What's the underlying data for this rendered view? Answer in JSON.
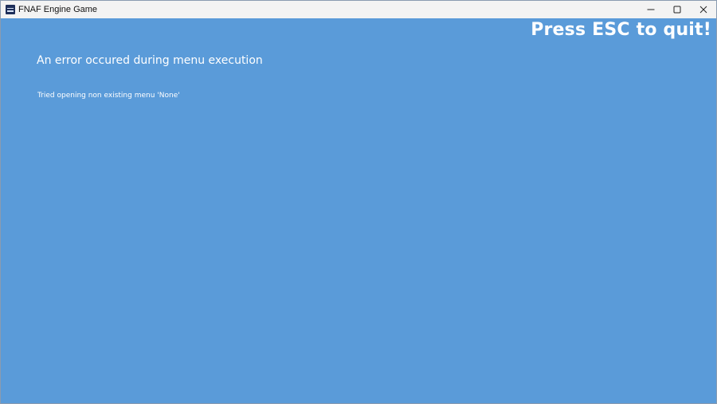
{
  "window": {
    "title": "FNAF Engine Game",
    "app_icon": "app-logo-icon",
    "controls": [
      "minimize-icon",
      "maximize-icon",
      "close-icon"
    ]
  },
  "content": {
    "background_color": "#5a9bd9",
    "esc_hint": "Press ESC to quit!",
    "error_title": "An error occured during menu execution",
    "error_detail": "Tried opening non existing menu 'None'"
  }
}
